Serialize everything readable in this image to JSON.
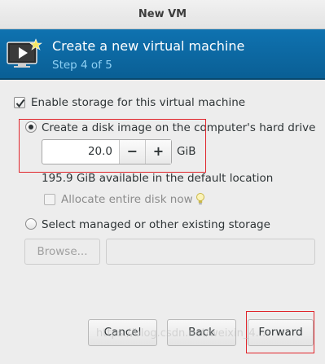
{
  "window": {
    "title": "New VM"
  },
  "banner": {
    "title": "Create a new virtual machine",
    "step": "Step 4 of 5",
    "icon": "vm-monitor-icon"
  },
  "storage": {
    "enable_label": "Enable storage for this virtual machine",
    "enable_checked": true,
    "create_disk_label": "Create a disk image on the computer's hard drive",
    "create_disk_selected": true,
    "size_value": "20.0",
    "size_unit": "GiB",
    "decrement_label": "−",
    "increment_label": "+",
    "available_text": "195.9 GiB available in the default location",
    "allocate_label": "Allocate entire disk now",
    "allocate_checked": false,
    "existing_label": "Select managed or other existing storage",
    "existing_selected": false,
    "browse_label": "Browse...",
    "path_value": ""
  },
  "footer": {
    "cancel_label": "Cancel",
    "back_label": "Back",
    "forward_label": "Forward"
  },
  "overlay": {
    "watermark": "https://blog.csdn.net/weixin_4..."
  },
  "colors": {
    "banner": "#0f72b0",
    "step_text": "#8fd1f5",
    "highlight": "#e0252b"
  }
}
